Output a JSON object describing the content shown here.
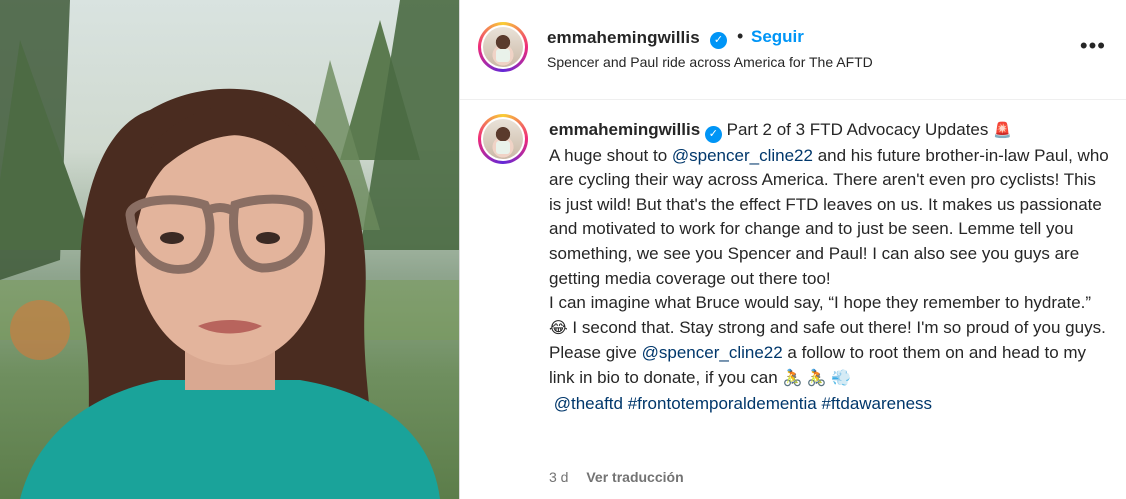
{
  "post": {
    "username": "emmahemingwillis",
    "verified_mark": "✓",
    "separator": "•",
    "follow_label": "Seguir",
    "subtitle": "Spencer and Paul ride across America for The AFTD",
    "more_icon": "•••"
  },
  "caption": {
    "username": "emmahemingwillis",
    "heading": "Part 2 of 3 FTD Advocacy Updates",
    "heading_emoji": "🚨",
    "text1": "A huge shout to ",
    "mention1": "@spencer_cline22",
    "text2": " and his future brother-in-law Paul, who are cycling their way across America. There aren't even pro cyclists! This is just wild! But that's the effect FTD leaves on us. It makes us passionate and motivated to work for change and to just be seen. Lemme tell you something, we see you Spencer and Paul! I can also see you guys are getting media coverage out there too!",
    "text3": "I can imagine what Bruce would say, “I hope they remember to hydrate.” ",
    "emoji_laugh": "😂",
    "text4": " I second that. Stay strong and safe out there! I'm so proud of you guys.",
    "text5": "Please give ",
    "mention2": "@spencer_cline22",
    "text6": " a follow to root them on and head to my link in bio to donate, if you can ",
    "emoji_bikes": "🚴 🚴 💨",
    "tag1": "@theaftd",
    "tag2": "#frontotemporaldementia",
    "tag3": "#ftdawareness"
  },
  "meta": {
    "time": "3 d",
    "translate_label": "Ver traducción"
  },
  "icons": {
    "more": "more-options-icon",
    "verified": "verified-badge-icon"
  },
  "colors": {
    "accent": "#0095f6",
    "link": "#00376b",
    "muted": "#737373"
  }
}
